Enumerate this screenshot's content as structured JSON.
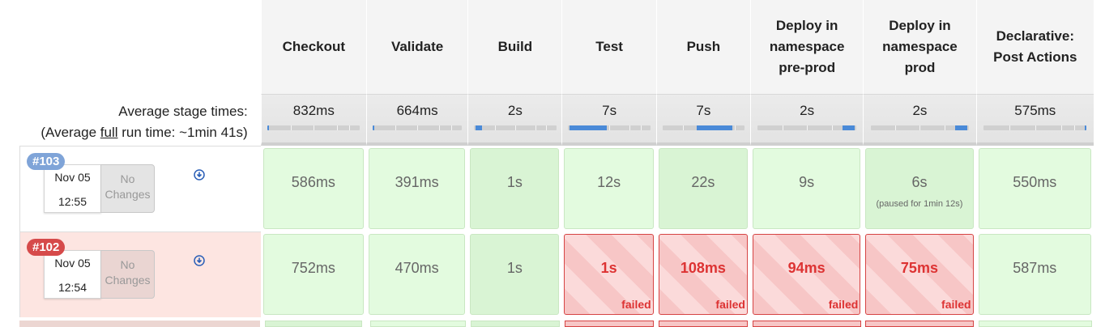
{
  "header": {
    "stages": [
      "Checkout",
      "Validate",
      "Build",
      "Test",
      "Push",
      "Deploy in namespace pre-prod",
      "Deploy in namespace prod",
      "Declarative: Post Actions"
    ]
  },
  "average": {
    "label_line1": "Average stage times:",
    "label_line2_prefix": "(Average ",
    "label_line2_link": "full",
    "label_line2_suffix": " run time: ~1min 41s)",
    "times": [
      "832ms",
      "664ms",
      "2s",
      "7s",
      "7s",
      "2s",
      "2s",
      "575ms"
    ],
    "bar_fill": [
      {
        "start": 0.0,
        "end": 0.01
      },
      {
        "start": 0.0,
        "end": 0.01
      },
      {
        "start": 0.02,
        "end": 0.1
      },
      {
        "start": 0.02,
        "end": 0.47
      },
      {
        "start": 0.42,
        "end": 0.85
      },
      {
        "start": 0.86,
        "end": 0.98
      },
      {
        "start": 0.86,
        "end": 0.98
      },
      {
        "start": 0.98,
        "end": 1.0
      }
    ]
  },
  "builds": [
    {
      "number": "#103",
      "status": "success",
      "date": "Nov 05",
      "time": "12:55",
      "changes": "No Changes",
      "stages": [
        {
          "time": "586ms",
          "status": "success"
        },
        {
          "time": "391ms",
          "status": "success"
        },
        {
          "time": "1s",
          "status": "success"
        },
        {
          "time": "12s",
          "status": "success"
        },
        {
          "time": "22s",
          "status": "success"
        },
        {
          "time": "9s",
          "status": "success"
        },
        {
          "time": "6s",
          "status": "success",
          "note": "(paused for 1min 12s)"
        },
        {
          "time": "550ms",
          "status": "success"
        }
      ]
    },
    {
      "number": "#102",
      "status": "failed",
      "date": "Nov 05",
      "time": "12:54",
      "changes": "No Changes",
      "stages": [
        {
          "time": "752ms",
          "status": "success"
        },
        {
          "time": "470ms",
          "status": "success"
        },
        {
          "time": "1s",
          "status": "success"
        },
        {
          "time": "1s",
          "status": "failed",
          "tag": "failed"
        },
        {
          "time": "108ms",
          "status": "failed",
          "tag": "failed"
        },
        {
          "time": "94ms",
          "status": "failed",
          "tag": "failed"
        },
        {
          "time": "75ms",
          "status": "failed",
          "tag": "failed"
        },
        {
          "time": "587ms",
          "status": "success"
        }
      ]
    }
  ],
  "colors": {
    "success_cell": "#e3fbdf",
    "failed_cell": "#f7c6c6",
    "failed_text": "#dd3333",
    "badge_success": "#7fa4d8",
    "badge_failed": "#d64a4a",
    "bar_fill": "#4a8ad8"
  }
}
